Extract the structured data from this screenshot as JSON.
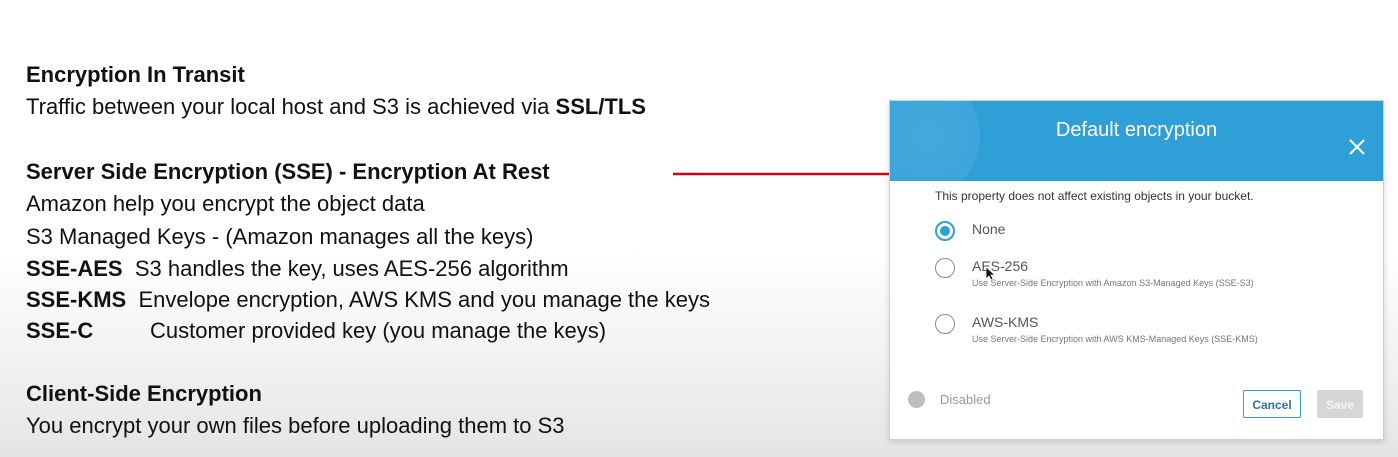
{
  "slide": {
    "transit_heading": "Encryption In Transit",
    "transit_text": "Traffic between your local host and S3 is achieved via ",
    "transit_bold": "SSL/TLS",
    "sse_heading": "Server Side Encryption (SSE) - Encryption At Rest",
    "sse_line1": "Amazon help you encrypt the object data",
    "sse_line2": "S3 Managed Keys -  (Amazon manages all the keys)",
    "sse_aes_term": "SSE-AES",
    "sse_aes_desc": "S3 handles the key, uses AES-256 algorithm",
    "sse_kms_term": "SSE-KMS",
    "sse_kms_desc": "Envelope encryption, AWS KMS and you manage the keys",
    "sse_c_term": "SSE-C",
    "sse_c_desc": "Customer provided key (you manage the keys)",
    "client_heading": "Client-Side Encryption",
    "client_text": "You encrypt your own files before uploading them to S3"
  },
  "dialog": {
    "title": "Default encryption",
    "note": "This property does not affect existing objects in your bucket.",
    "options": [
      {
        "label": "None",
        "description": "",
        "checked": true
      },
      {
        "label": "AES-256",
        "description": "Use Server-Side Encryption with Amazon S3-Managed Keys (SSE-S3)",
        "checked": false
      },
      {
        "label": "AWS-KMS",
        "description": "Use Server-Side Encryption with AWS KMS-Managed Keys (SSE-KMS)",
        "checked": false
      }
    ],
    "status_label": "Disabled",
    "cancel_label": "Cancel",
    "save_label": "Save"
  },
  "colors": {
    "accent": "#2f9fd8",
    "arrow": "#d0021b"
  }
}
